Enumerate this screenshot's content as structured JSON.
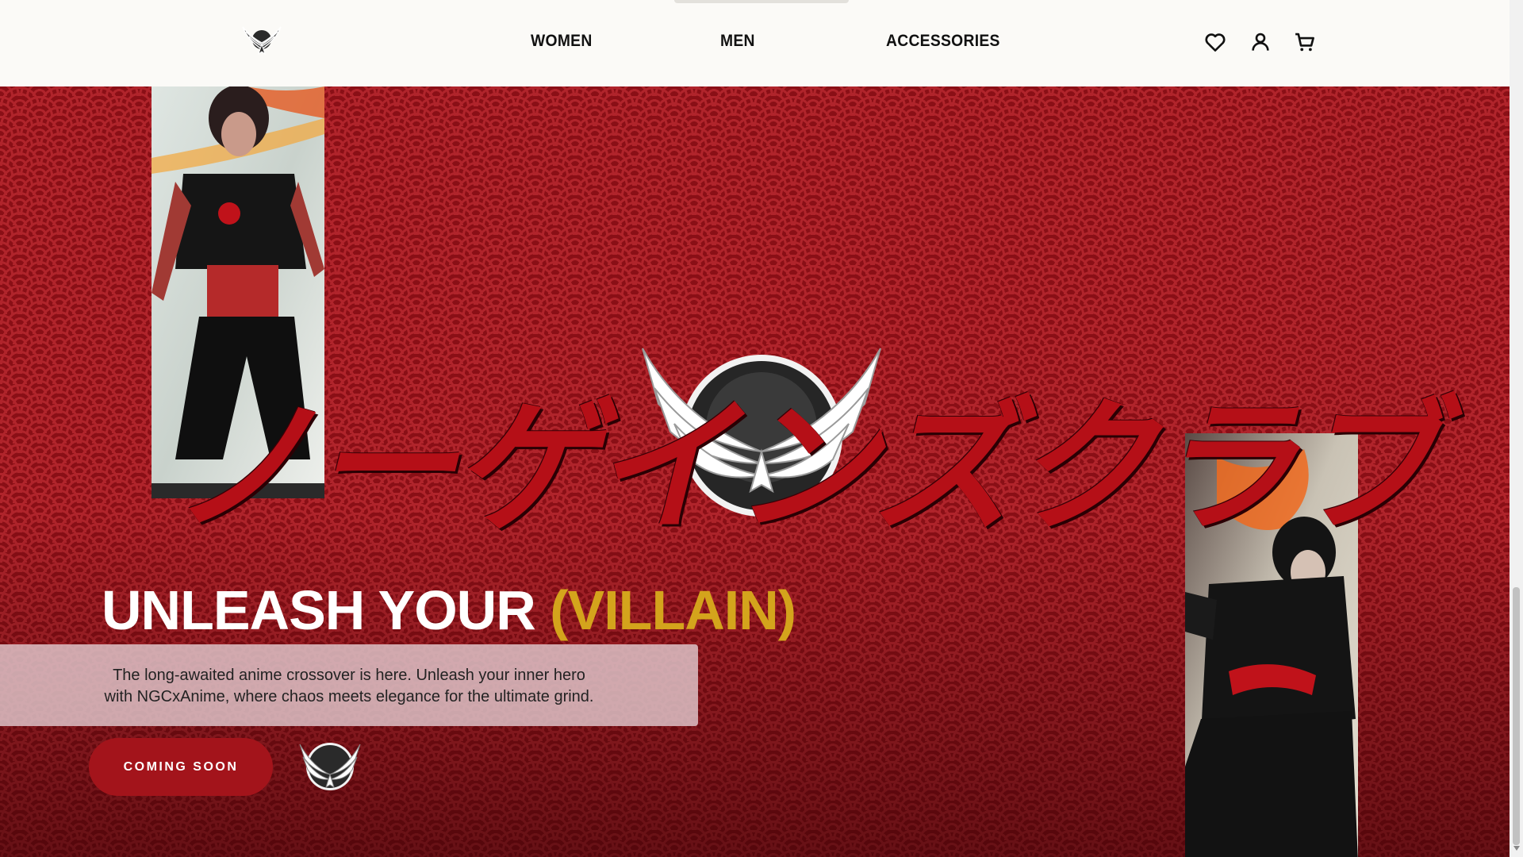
{
  "header": {
    "logo_icon": "winged-eagle-logo-icon",
    "nav": [
      {
        "label": "WOMEN"
      },
      {
        "label": "MEN"
      },
      {
        "label": "ACCESSORIES"
      }
    ],
    "icons": {
      "wishlist": "heart-icon",
      "account": "user-icon",
      "cart": "cart-icon"
    }
  },
  "hero": {
    "kana": "ノーゲインズクラブ",
    "headline_prefix": "UNLEASH YOUR",
    "headline_accent": "(VILLAIN)",
    "tagline_line1": "The long-awaited anime crossover is here. Unleash your inner hero",
    "tagline_line2": "with NGCxAnime, where chaos meets elegance for the ultimate grind.",
    "cta_label": "COMING SOON",
    "colors": {
      "background": "#8a0f16",
      "pattern": "#b0242b",
      "accent_gold": "#d4a41c",
      "button": "#a3141b"
    }
  }
}
